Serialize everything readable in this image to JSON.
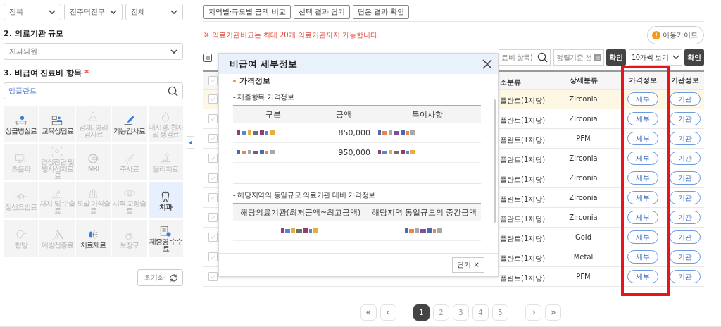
{
  "region_selects": [
    {
      "value": "전북"
    },
    {
      "value": "전주덕진구"
    },
    {
      "value": "전체"
    }
  ],
  "scale_section": {
    "heading": "2. 의료기관 규모",
    "select_value": "치과의원"
  },
  "item_section": {
    "heading": "3. 비급여 진료비 항목",
    "required_mark": "*",
    "search_value": "임플란트"
  },
  "categories": [
    {
      "label": "상급병실료",
      "disabled": false,
      "selected": false
    },
    {
      "label": "교육상담료",
      "disabled": false,
      "selected": false
    },
    {
      "label": "검체, 병리 검사료",
      "disabled": true,
      "selected": false
    },
    {
      "label": "기능검사료",
      "disabled": false,
      "selected": false
    },
    {
      "label": "내시경, 천자 및 생검료",
      "disabled": true,
      "selected": false
    },
    {
      "label": "초음파",
      "disabled": true,
      "selected": false
    },
    {
      "label": "영상진단 및 방사선치료료",
      "disabled": true,
      "selected": false
    },
    {
      "label": "MRI",
      "disabled": true,
      "selected": false
    },
    {
      "label": "주사료",
      "disabled": true,
      "selected": false
    },
    {
      "label": "물리치료",
      "disabled": true,
      "selected": false
    },
    {
      "label": "정신요법료",
      "disabled": true,
      "selected": false
    },
    {
      "label": "처치 및 수술료",
      "disabled": true,
      "selected": false
    },
    {
      "label": "모발 이식술료",
      "disabled": true,
      "selected": false
    },
    {
      "label": "시력 교정술료",
      "disabled": true,
      "selected": false
    },
    {
      "label": "치과",
      "disabled": false,
      "selected": true
    },
    {
      "label": "한방",
      "disabled": true,
      "selected": false
    },
    {
      "label": "예방접종료",
      "disabled": true,
      "selected": false
    },
    {
      "label": "치료재료",
      "disabled": false,
      "selected": false
    },
    {
      "label": "보장구",
      "disabled": true,
      "selected": false
    },
    {
      "label": "제증명 수수료",
      "disabled": false,
      "selected": false
    }
  ],
  "reset_button": "초기화",
  "top_buttons": [
    "지역별·규모별 금액 비교",
    "선택 결과 담기",
    "담은 결과 확인"
  ],
  "notice": "※ 의료기관비교는 최대 20개 의료기관까지 가능합니다.",
  "guide_button": "이용가이드",
  "results_toolbar": {
    "search_placeholder": "료비 항목)",
    "sort_placeholder": "정렬기준 선",
    "sort_button": "확인",
    "page_size": "10개씩 보기",
    "page_size_button": "확인"
  },
  "table": {
    "select_all_checked": false,
    "columns": [
      "소분류",
      "상세분류",
      "가격정보",
      "기관정보"
    ],
    "rows": [
      {
        "selected": true,
        "checked": false,
        "subcategory": "플란트(1치당)",
        "detail": "Zirconia",
        "price_button": "세부",
        "org_button": "기관"
      },
      {
        "selected": false,
        "checked": false,
        "subcategory": "플란트(1치당)",
        "detail": "Zirconia",
        "price_button": "세부",
        "org_button": "기관"
      },
      {
        "selected": false,
        "checked": false,
        "subcategory": "플란트(1치당)",
        "detail": "PFM",
        "price_button": "세부",
        "org_button": "기관"
      },
      {
        "selected": false,
        "checked": false,
        "subcategory": "플란트(1치당)",
        "detail": "Zirconia",
        "price_button": "세부",
        "org_button": "기관"
      },
      {
        "selected": false,
        "checked": false,
        "subcategory": "플란트(1치당)",
        "detail": "Zirconia",
        "price_button": "세부",
        "org_button": "기관"
      },
      {
        "selected": false,
        "checked": false,
        "subcategory": "플란트(1치당)",
        "detail": "Zirconia",
        "price_button": "세부",
        "org_button": "기관"
      },
      {
        "selected": false,
        "checked": false,
        "subcategory": "플란트(1치당)",
        "detail": "Zirconia",
        "price_button": "세부",
        "org_button": "기관"
      },
      {
        "selected": false,
        "checked": false,
        "subcategory": "플란트(1치당)",
        "detail": "Gold",
        "price_button": "세부",
        "org_button": "기관"
      },
      {
        "selected": false,
        "checked": false,
        "subcategory": "플란트(1치당)",
        "detail": "Metal",
        "price_button": "세부",
        "org_button": "기관"
      },
      {
        "selected": false,
        "checked": false,
        "subcategory": "플란트(1치당)",
        "detail": "PFM",
        "price_button": "세부",
        "org_button": "기관"
      }
    ]
  },
  "modal": {
    "title": "비급여 세부정보",
    "section": "가격정보",
    "submitted_heading": "- 제출항목 가격정보",
    "submitted_table": {
      "columns": [
        "구분",
        "금액",
        "특이사항"
      ],
      "rows": [
        {
          "item": {
            "kind": "redacted"
          },
          "amount": "850,000",
          "note": {
            "kind": "redacted"
          }
        },
        {
          "item": {
            "kind": "redacted"
          },
          "amount": "950,000",
          "note": {
            "kind": "redacted"
          }
        }
      ]
    },
    "comparison_heading": "- 해당지역의 동일규모 의료기관 대비 가격정보",
    "comparison_table": {
      "columns": [
        "해당의료기관(최저금액~최고금액)",
        "해당지역 동일규모의 중간금액"
      ],
      "rows": [
        {
          "range": {
            "kind": "redacted"
          },
          "median": {
            "kind": "redacted"
          }
        }
      ]
    },
    "close_button": "닫기 ×"
  },
  "pagination": [
    {
      "label": "1",
      "selected": true
    },
    {
      "label": "2",
      "selected": false
    },
    {
      "label": "3",
      "selected": false
    },
    {
      "label": "4",
      "selected": false
    },
    {
      "label": "5",
      "selected": false
    }
  ]
}
